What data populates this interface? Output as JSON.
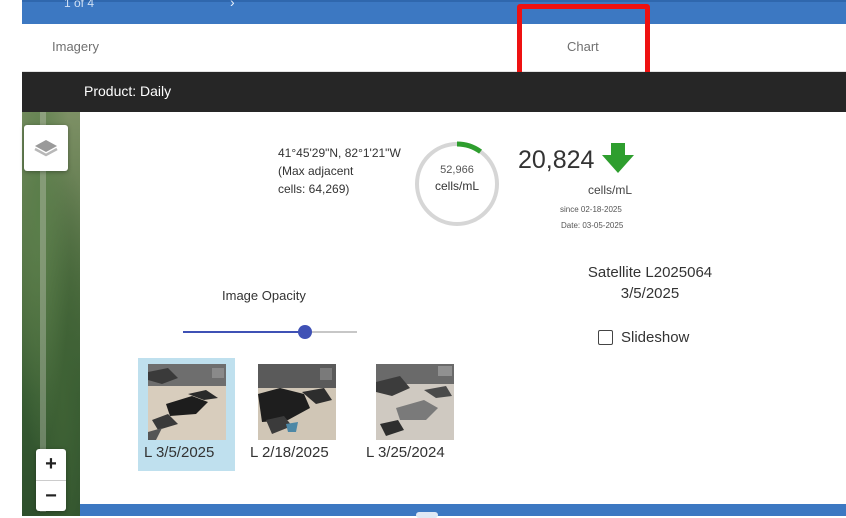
{
  "topbar": {
    "text": "1 of 4",
    "chevron": "›"
  },
  "tabs": [
    {
      "label": "Imagery"
    },
    {
      "label": "Chart"
    }
  ],
  "product": {
    "label": "Product: Daily"
  },
  "map": {
    "zoom_in": "+",
    "zoom_out": "−",
    "layers_icon": "layers-icon"
  },
  "location": {
    "coords": "41°45'29\"N, 82°1'21\"W",
    "max_line1": "(Max adjacent",
    "max_line2": "cells: 64,269)"
  },
  "ring": {
    "value": "52,966",
    "unit": "cells/mL",
    "progress_fraction": 0.1
  },
  "current": {
    "value": "20,824",
    "trend": "down",
    "trend_color": "#2e9e2e",
    "unit": "cells/mL",
    "since": "since 02-18-2025",
    "date": "Date: 03-05-2025"
  },
  "satellite": {
    "line1": "Satellite L2025064",
    "line2": "3/5/2025"
  },
  "slideshow": {
    "label": "Slideshow",
    "checked": false
  },
  "opacity": {
    "label": "Image Opacity",
    "value_fraction": 0.7,
    "accent": "#3f51b5"
  },
  "thumbnails": [
    {
      "label": "L 3/5/2025",
      "selected": true
    },
    {
      "label": "L 2/18/2025",
      "selected": false
    },
    {
      "label": "L 3/25/2024",
      "selected": false
    }
  ]
}
